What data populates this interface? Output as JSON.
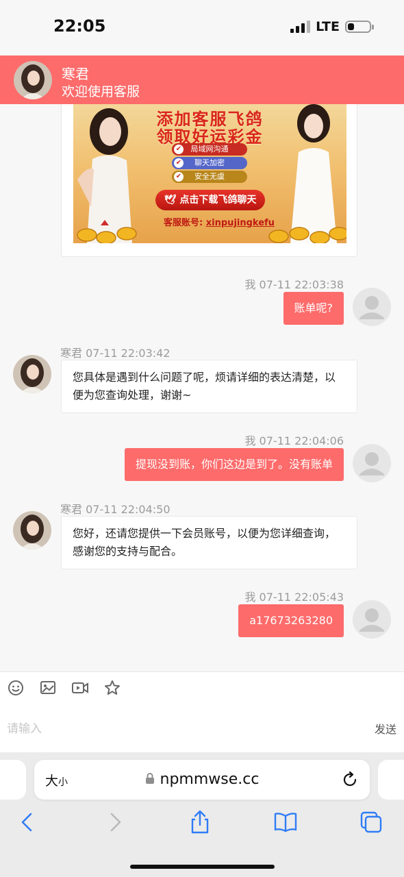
{
  "status_bar": {
    "time": "22:05",
    "network": "LTE",
    "battery_level": 0.3
  },
  "header": {
    "name": "寒君",
    "subtitle": "欢迎使用客服"
  },
  "banner": {
    "title_line1": "添加客服飞鸽",
    "title_line2": "领取好运彩金",
    "features": [
      "局域网沟通",
      "聊天加密",
      "安全无虞"
    ],
    "download_label": "点击下载飞鸽聊天",
    "account_label": "客服账号:",
    "account_value": "xinpujingkefu"
  },
  "messages": [
    {
      "side": "right",
      "meta": "我 07-11 22:03:38",
      "text": "账单呢?"
    },
    {
      "side": "left",
      "meta": "寒君  07-11 22:03:42",
      "text": "您具体是遇到什么问题了呢，烦请详细的表达清楚，以便为您查询处理，谢谢~"
    },
    {
      "side": "right",
      "meta": "我 07-11 22:04:06",
      "text": "提现没到账，你们这边是到了。没有账单"
    },
    {
      "side": "left",
      "meta": "寒君  07-11 22:04:50",
      "text": "您好，还请您提供一下会员账号，以便为您详细查询，感谢您的支持与配合。"
    },
    {
      "side": "right",
      "meta": "我 07-11 22:05:43",
      "text": "a17673263280"
    }
  ],
  "toolbar": {
    "icons": [
      "emoji-icon",
      "image-icon",
      "video-icon",
      "star-icon"
    ]
  },
  "input": {
    "placeholder": "请输入",
    "send_label": "发送"
  },
  "browser": {
    "reader_big": "大",
    "reader_small": "小",
    "url": "npmmwse.cc",
    "nav_icons": [
      "back-icon",
      "forward-icon",
      "share-icon",
      "bookmarks-icon",
      "tabs-icon"
    ]
  },
  "colors": {
    "accent": "#fd6b6b",
    "ios_blue": "#2f7cf6"
  }
}
